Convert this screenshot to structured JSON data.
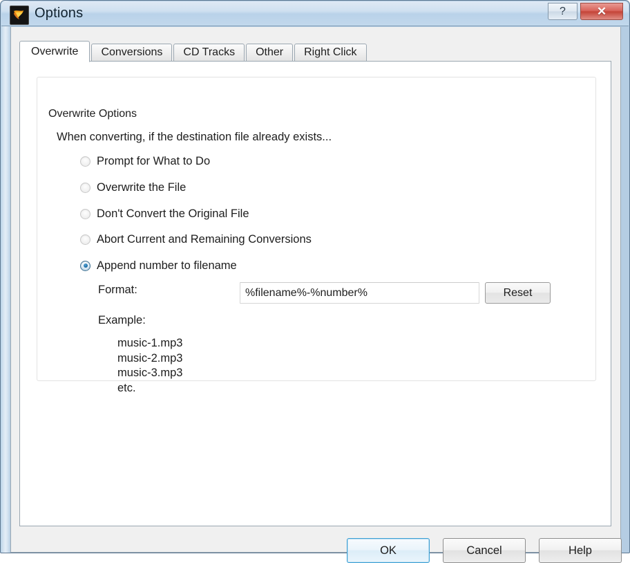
{
  "window": {
    "title": "Options",
    "icon": "flame-app-icon",
    "help_button": "?",
    "close_button": "✕"
  },
  "tabs": [
    {
      "label": "Overwrite",
      "active": true
    },
    {
      "label": "Conversions",
      "active": false
    },
    {
      "label": "CD Tracks",
      "active": false
    },
    {
      "label": "Other",
      "active": false
    },
    {
      "label": "Right Click",
      "active": false
    }
  ],
  "group": {
    "legend": "Overwrite Options",
    "intro": "When converting, if the destination file already exists..."
  },
  "radios": [
    {
      "label": "Prompt for What to Do",
      "checked": false
    },
    {
      "label": "Overwrite the File",
      "checked": false
    },
    {
      "label": "Don't Convert the Original File",
      "checked": false
    },
    {
      "label": "Abort Current and Remaining Conversions",
      "checked": false
    },
    {
      "label": "Append number to filename",
      "checked": true
    }
  ],
  "format": {
    "label": "Format:",
    "value": "%filename%-%number%",
    "placeholder": "",
    "reset_label": "Reset"
  },
  "example": {
    "label": "Example:",
    "lines": "music-1.mp3\nmusic-2.mp3\nmusic-3.mp3\netc."
  },
  "footer": {
    "ok_label": "OK",
    "cancel_label": "Cancel",
    "help_label": "Help"
  },
  "colors": {
    "accent": "#3c9fd4",
    "close_red": "#c44438",
    "radio_dot": "#1c6fa8",
    "titlebar": "#b9d2e9"
  }
}
